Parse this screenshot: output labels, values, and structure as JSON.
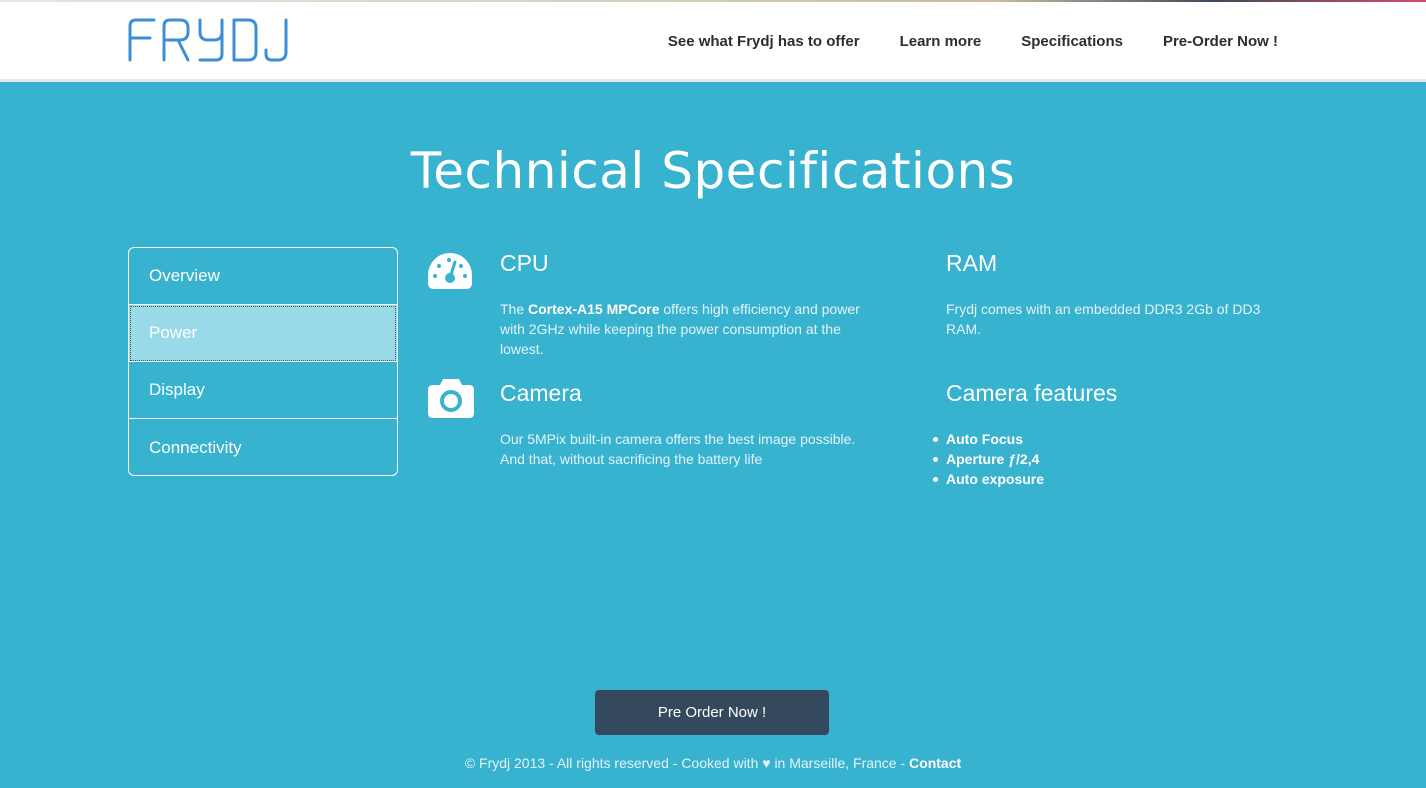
{
  "header": {
    "logo_text": "FRYDJ",
    "nav": [
      {
        "label": "See what Frydj has to offer"
      },
      {
        "label": "Learn more"
      },
      {
        "label": "Specifications"
      },
      {
        "label": "Pre-Order Now !"
      }
    ]
  },
  "main": {
    "title": "Technical Specifications",
    "tabs": [
      {
        "label": "Overview"
      },
      {
        "label": "Power"
      },
      {
        "label": "Display"
      },
      {
        "label": "Connectivity"
      }
    ],
    "active_tab": "Power",
    "specs": {
      "cpu": {
        "title": "CPU",
        "text_before": "The ",
        "text_bold": "Cortex-A15 MPCore",
        "text_after": " offers high efficiency and power with 2GHz while keeping the power consumption at the lowest.",
        "icon": "speedometer-icon"
      },
      "ram": {
        "title": "RAM",
        "text": "Frydj comes with an embedded DDR3 2Gb of DD3 RAM."
      },
      "camera": {
        "title": "Camera",
        "text": "Our 5MPix built-in camera offers the best image possible. And that, without sacrificing the battery life",
        "icon": "camera-icon"
      },
      "camera_features": {
        "title": "Camera features",
        "items": [
          "Auto Focus",
          "Aperture ƒ/2,4",
          "Auto exposure"
        ]
      }
    }
  },
  "cta": {
    "label": "Pre Order Now !"
  },
  "footer": {
    "text": "© Frydj 2013 - All rights reserved - Cooked with ♥ in Marseille, France - ",
    "contact_label": "Contact"
  },
  "colors": {
    "background": "#37b2cf",
    "header": "#ffffff",
    "logo": "#3c8fd6",
    "button": "#34495e",
    "active_tab": "#99d9e8"
  }
}
